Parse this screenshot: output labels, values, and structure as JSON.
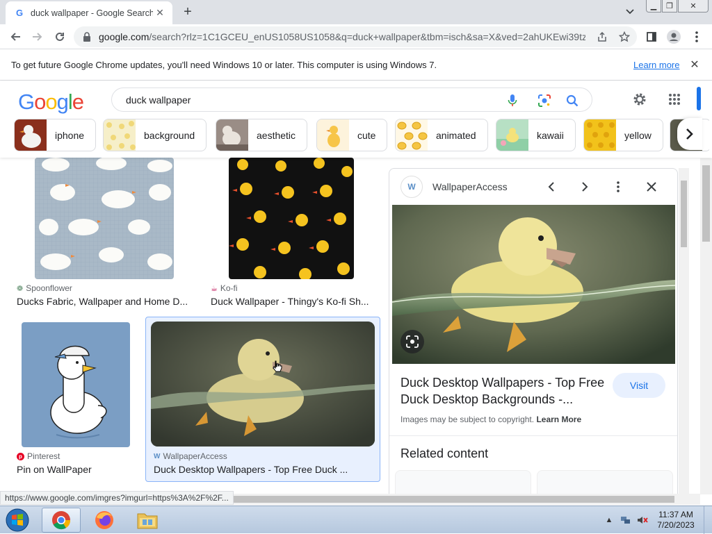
{
  "browser": {
    "tab_title": "duck wallpaper - Google Search",
    "tab_favicon": "G",
    "new_tab_label": "+",
    "url_host": "google.com",
    "url_path": "/search?rlz=1C1GCEU_enUS1058US1058&q=duck+wallpaper&tbm=isch&sa=X&ved=2ahUKEwi39tz..."
  },
  "infobar": {
    "message": "To get future Google Chrome updates, you'll need Windows 10 or later. This computer is using Windows 7.",
    "link": "Learn more"
  },
  "google": {
    "logo": "Google",
    "query": "duck wallpaper",
    "chips": [
      {
        "label": "iphone"
      },
      {
        "label": "background"
      },
      {
        "label": "aesthetic"
      },
      {
        "label": "cute"
      },
      {
        "label": "animated"
      },
      {
        "label": "kawaii"
      },
      {
        "label": "yellow"
      }
    ]
  },
  "results": [
    {
      "source": "Spoonflower",
      "title": "Ducks Fabric, Wallpaper and Home D..."
    },
    {
      "source": "Ko-fi",
      "title": "Duck Wallpaper - Thingy's Ko-fi Sh..."
    },
    {
      "source": "Pinterest",
      "title": "Pin on WallPaper"
    },
    {
      "source": "WallpaperAccess",
      "title": "Duck Desktop Wallpapers - Top Free Duck ..."
    }
  ],
  "preview": {
    "source_logo": "W",
    "source_name": "WallpaperAccess",
    "title_line1": "Duck Desktop Wallpapers - Top Free",
    "title_line2": "Duck Desktop Backgrounds -...",
    "visit": "Visit",
    "copyright": "Images may be subject to copyright.",
    "learn_more": "Learn More",
    "related": "Related content"
  },
  "status_url": "https://www.google.com/imgres?imgurl=https%3A%2F%2F...",
  "taskbar": {
    "time": "11:37 AM",
    "date": "7/20/2023"
  },
  "colors": {
    "accent": "#1a73e8",
    "selected_bg": "#e8f0fe"
  }
}
